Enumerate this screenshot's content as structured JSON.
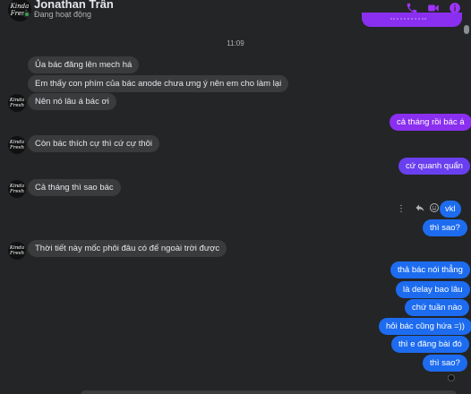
{
  "header": {
    "contact_name": "Jonathan Trần",
    "status": "Đang hoạt động",
    "avatar_text": "Kinda Fresh",
    "accent_color": "#a033ff"
  },
  "conversation": {
    "timestamp": "11:09",
    "messages": [
      {
        "sender": "them",
        "text": "Ủa bác đăng lên mech há"
      },
      {
        "sender": "them",
        "text": "Em thấy con phím của bác anode chưa ưng ý nên em cho làm lại"
      },
      {
        "sender": "them",
        "text": "Nên nó lâu á bác ơi"
      },
      {
        "sender": "me",
        "text": "cả tháng rồi bác á"
      },
      {
        "sender": "them",
        "text": "Còn bác thích cự thì cứ cự thôi"
      },
      {
        "sender": "me",
        "text": "cứ quanh quẩn"
      },
      {
        "sender": "them",
        "text": "Cả tháng thì sao bác"
      },
      {
        "sender": "me",
        "text": "vkl"
      },
      {
        "sender": "me",
        "text": "thì sao?"
      },
      {
        "sender": "them",
        "text": "Thời tiết này mốc phôi đâu có để ngoài trời được"
      },
      {
        "sender": "me",
        "text": "thả bác nói thẳng"
      },
      {
        "sender": "me",
        "text": "là delay bao lâu"
      },
      {
        "sender": "me",
        "text": "chứ tuần nào"
      },
      {
        "sender": "me",
        "text": "hỏi bác cũng hứa =))"
      },
      {
        "sender": "me",
        "text": "thì e đăng bài đó"
      },
      {
        "sender": "me",
        "text": "thì sao?"
      }
    ]
  },
  "colors": {
    "background": "#242526",
    "incoming_bubble": "#3a3b3c",
    "outgoing_purple": "#8a2ff0",
    "outgoing_violet": "#6a3ff0",
    "outgoing_blue": "#1d6cf0",
    "online": "#31a24c"
  },
  "icons": [
    "phone-icon",
    "video-icon",
    "info-icon",
    "more-icon",
    "reply-icon",
    "emoji-icon"
  ]
}
